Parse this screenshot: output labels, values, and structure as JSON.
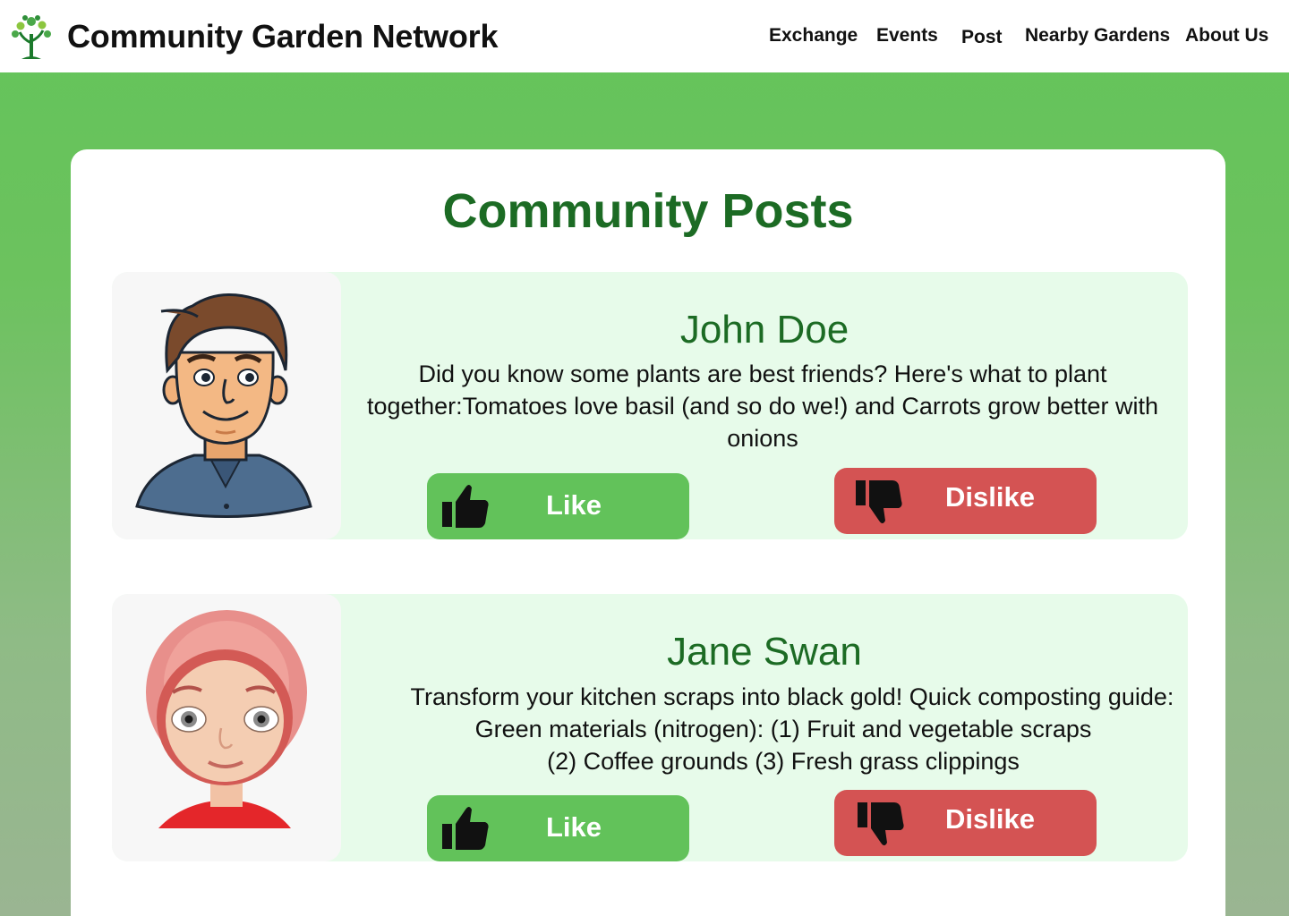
{
  "header": {
    "brand": "Community Garden Network",
    "logo_icon": "tree-logo-icon",
    "nav": [
      {
        "label": "Exchange"
      },
      {
        "label": "Events"
      },
      {
        "label": "Post"
      },
      {
        "label": "Nearby Gardens"
      },
      {
        "label": "About Us"
      }
    ]
  },
  "main": {
    "title": "Community Posts",
    "posts": [
      {
        "author": "John Doe",
        "avatar": "cartoon-man-avatar",
        "text_lines": [
          "Did you know some plants are best friends? Here's what to plant",
          "together:Tomatoes love basil (and so do we!) and Carrots grow better with",
          "onions"
        ],
        "like_label": "Like",
        "dislike_label": "Dislike"
      },
      {
        "author": "Jane Swan",
        "avatar": "cartoon-girl-avatar",
        "text_lines": [
          "Transform your kitchen scraps into black gold! Quick composting guide:",
          "Green materials (nitrogen): (1) Fruit and vegetable scraps",
          "(2) Coffee grounds (3) Fresh grass clippings"
        ],
        "like_label": "Like",
        "dislike_label": "Dislike"
      }
    ]
  },
  "colors": {
    "brand_green": "#1c6b24",
    "like_green": "#62c25a",
    "dislike_red": "#d45353",
    "post_bg": "#e7fbea"
  }
}
